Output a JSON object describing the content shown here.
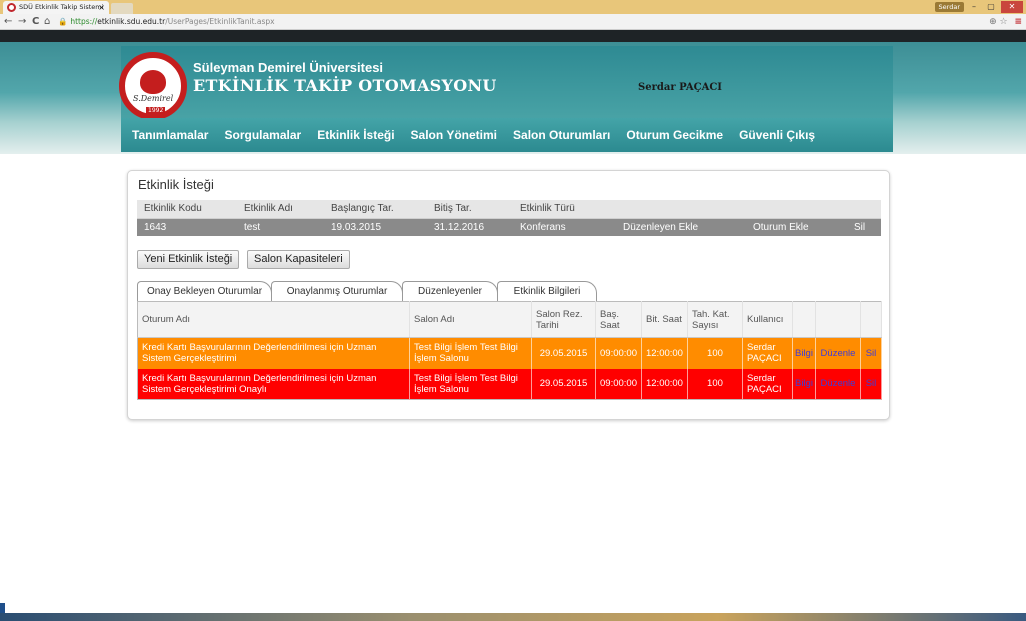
{
  "browser": {
    "tab_title": "SDÜ Etkinlik Takip Sistemi",
    "tab_close": "×",
    "user_chip": "Serdar",
    "win_min": "–",
    "win_max": "▢",
    "win_close": "✕",
    "nav_back": "←",
    "nav_forward": "→",
    "nav_reload": "C",
    "nav_home": "⌂",
    "url_scheme": "https://",
    "url_host": "etkinlik.sdu.edu.tr",
    "url_path": "/UserPages/EtkinlikTanit.aspx",
    "addr_zoom": "⊕",
    "addr_star": "☆",
    "addr_menu": "≡"
  },
  "header": {
    "logo_signature": "S.Demirel",
    "logo_year": "1992",
    "university": "Süleyman Demirel Üniversitesi",
    "system": "ETKİNLİK TAKİP OTOMASYONU",
    "user": "Serdar PAÇACI"
  },
  "menu": [
    "Tanımlamalar",
    "Sorgulamalar",
    "Etkinlik İsteği",
    "Salon Yönetimi",
    "Salon Oturumları",
    "Oturum Gecikme",
    "Güvenli Çıkış"
  ],
  "panel": {
    "title": "Etkinlik İsteği",
    "event_grid": {
      "headers": [
        "Etkinlik Kodu",
        "Etkinlik Adı",
        "Başlangıç Tar.",
        "Bitiş Tar.",
        "Etkinlik Türü",
        "",
        "",
        ""
      ],
      "row": {
        "code": "1643",
        "name": "test",
        "start": "19.03.2015",
        "end": "31.12.2016",
        "type": "Konferans",
        "add_organizer": "Düzenleyen Ekle",
        "add_session": "Oturum Ekle",
        "delete": "Sil"
      }
    },
    "buttons": {
      "new_request": "Yeni Etkinlik İsteği",
      "hall_capacities": "Salon Kapasiteleri"
    },
    "tabs": [
      "Onay Bekleyen Oturumlar",
      "Onaylanmış Oturumlar",
      "Düzenleyenler",
      "Etkinlik Bilgileri"
    ],
    "session_grid": {
      "headers": {
        "session": "Oturum Adı",
        "hall": "Salon Adı",
        "res_date": "Salon Rez. Tarihi",
        "start_time": "Baş. Saat",
        "end_time": "Bit. Saat",
        "capacity": "Tah. Kat. Sayısı",
        "user": "Kullanıcı"
      },
      "rows": [
        {
          "session": "Kredi Kartı Başvurularının Değerlendirilmesi için Uzman Sistem Gerçekleştirimi",
          "hall": "Test Bilgi İşlem Test Bilgi İşlem Salonu",
          "date": "29.05.2015",
          "start": "09:00:00",
          "end": "12:00:00",
          "capacity": "100",
          "user": "Serdar PAÇACI",
          "info": "Bilgi",
          "edit": "Düzenle",
          "delete": "Sil"
        },
        {
          "session": "Kredi Kartı Başvurularının Değerlendirilmesi için Uzman Sistem Gerçekleştirimi Onaylı",
          "hall": "Test Bilgi İşlem Test Bilgi İşlem Salonu",
          "date": "29.05.2015",
          "start": "09:00:00",
          "end": "12:00:00",
          "capacity": "100",
          "user": "Serdar PAÇACI",
          "info": "Bilgi",
          "edit": "Düzenle",
          "delete": "Sil"
        }
      ]
    }
  },
  "colors": {
    "teal": "#2c8a90",
    "pending_row": "#ff8c00",
    "approved_row": "#ff0000",
    "link": "#3d3dd8"
  }
}
